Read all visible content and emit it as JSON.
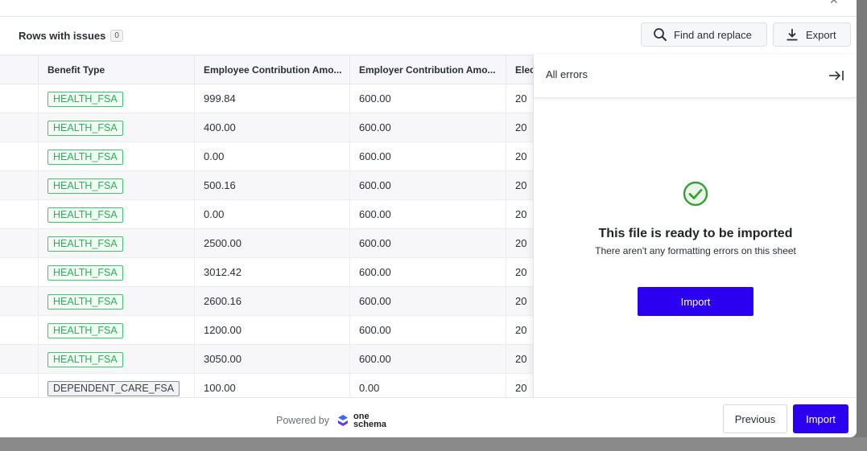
{
  "toolbar": {
    "rows_with_issues_label": "Rows with issues",
    "rows_with_issues_count": "0",
    "find_replace_label": "Find and replace",
    "export_label": "Export"
  },
  "grid": {
    "columns": [
      "Benefit Type",
      "Employee Contribution Amo...",
      "Employer Contribution Amo...",
      "Elec"
    ],
    "rows": [
      {
        "benefit_type": "HEALTH_FSA",
        "employee": "999.84",
        "employer": "600.00",
        "elec": "20"
      },
      {
        "benefit_type": "HEALTH_FSA",
        "employee": "400.00",
        "employer": "600.00",
        "elec": "20"
      },
      {
        "benefit_type": "HEALTH_FSA",
        "employee": "0.00",
        "employer": "600.00",
        "elec": "20"
      },
      {
        "benefit_type": "HEALTH_FSA",
        "employee": "500.16",
        "employer": "600.00",
        "elec": "20"
      },
      {
        "benefit_type": "HEALTH_FSA",
        "employee": "0.00",
        "employer": "600.00",
        "elec": "20"
      },
      {
        "benefit_type": "HEALTH_FSA",
        "employee": "2500.00",
        "employer": "600.00",
        "elec": "20"
      },
      {
        "benefit_type": "HEALTH_FSA",
        "employee": "3012.42",
        "employer": "600.00",
        "elec": "20"
      },
      {
        "benefit_type": "HEALTH_FSA",
        "employee": "2600.16",
        "employer": "600.00",
        "elec": "20"
      },
      {
        "benefit_type": "HEALTH_FSA",
        "employee": "1200.00",
        "employer": "600.00",
        "elec": "20"
      },
      {
        "benefit_type": "HEALTH_FSA",
        "employee": "3050.00",
        "employer": "600.00",
        "elec": "20"
      },
      {
        "benefit_type": "DEPENDENT_CARE_FSA",
        "employee": "100.00",
        "employer": "0.00",
        "elec": "20"
      }
    ]
  },
  "panel": {
    "title": "All errors",
    "ready_title": "This file is ready to be imported",
    "ready_subtitle": "There aren't any formatting errors on this sheet",
    "import_label": "Import"
  },
  "footer": {
    "powered_by": "Powered by",
    "logo_line1": "one",
    "logo_line2": "schema",
    "previous_label": "Previous",
    "import_label": "Import"
  },
  "colors": {
    "primary": "#2b00f0",
    "tag_green": "#2cad5a",
    "success_green": "#3a9e3a"
  }
}
